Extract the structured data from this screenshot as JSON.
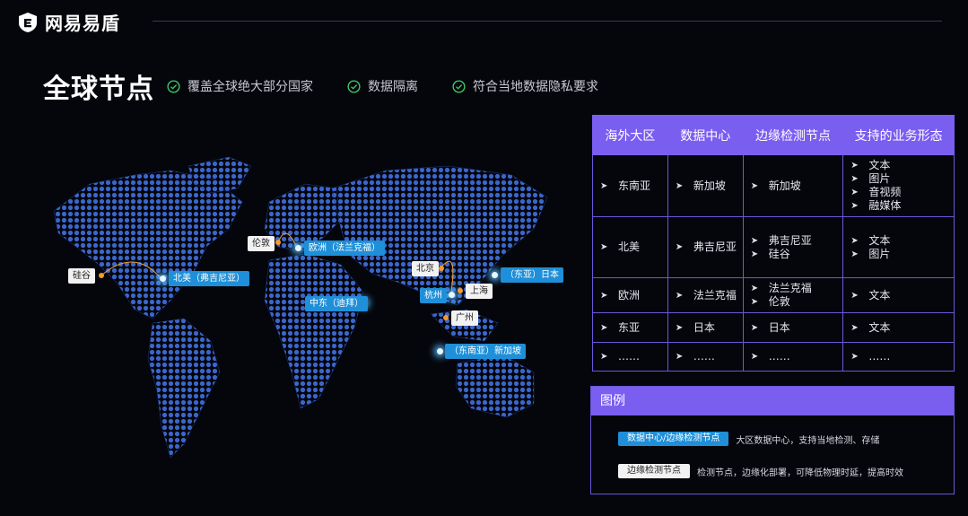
{
  "header": {
    "brand": "网易易盾",
    "logo_icon": "yidun-e-logo-icon"
  },
  "title_row": {
    "title": "全球节点",
    "features": [
      {
        "label": "覆盖全球绝大部分国家",
        "icon": "check-circle-icon"
      },
      {
        "label": "数据隔离",
        "icon": "check-circle-icon"
      },
      {
        "label": "符合当地数据隐私要求",
        "icon": "check-circle-icon"
      }
    ],
    "check_color": "#3fcf6b"
  },
  "map": {
    "dc_nodes": [
      {
        "label": "北美（弗吉尼亚）"
      },
      {
        "label": "欧洲（法兰克福）"
      },
      {
        "label": "中东（迪拜）"
      },
      {
        "label": "（东亚）日本"
      },
      {
        "label": "杭州"
      },
      {
        "label": "（东南亚）新加坡"
      }
    ],
    "edge_nodes": [
      {
        "label": "硅谷"
      },
      {
        "label": "伦敦"
      },
      {
        "label": "北京"
      },
      {
        "label": "上海"
      },
      {
        "label": "广州"
      }
    ],
    "land_color": "#2e56b8"
  },
  "table": {
    "headers": [
      "海外大区",
      "数据中心",
      "边缘检测节点",
      "支持的业务形态"
    ],
    "rows": [
      {
        "region": "东南亚",
        "dc": [
          "新加坡"
        ],
        "edge": [
          "新加坡"
        ],
        "biz": [
          "文本",
          "图片",
          "音视频",
          "融媒体"
        ]
      },
      {
        "region": "北美",
        "dc": [
          "弗吉尼亚"
        ],
        "edge": [
          "弗吉尼亚",
          "硅谷"
        ],
        "biz": [
          "文本",
          "图片"
        ]
      },
      {
        "region": "欧洲",
        "dc": [
          "法兰克福"
        ],
        "edge": [
          "法兰克福",
          "伦敦"
        ],
        "biz": [
          "文本"
        ]
      },
      {
        "region": "东亚",
        "dc": [
          "日本"
        ],
        "edge": [
          "日本"
        ],
        "biz": [
          "文本"
        ]
      },
      {
        "region": "……",
        "dc": [
          "……"
        ],
        "edge": [
          "……"
        ],
        "biz": [
          "……"
        ]
      }
    ],
    "header_color": "#7a5ef0",
    "arrow": "➤"
  },
  "legend": {
    "title": "图例",
    "items": [
      {
        "chip": "数据中心/边缘检测节点",
        "desc": "大区数据中心，支持当地检测、存储"
      },
      {
        "chip": "边缘检测节点",
        "desc": "检测节点，边缘化部署，可降低物理时延，提高时效"
      }
    ]
  }
}
